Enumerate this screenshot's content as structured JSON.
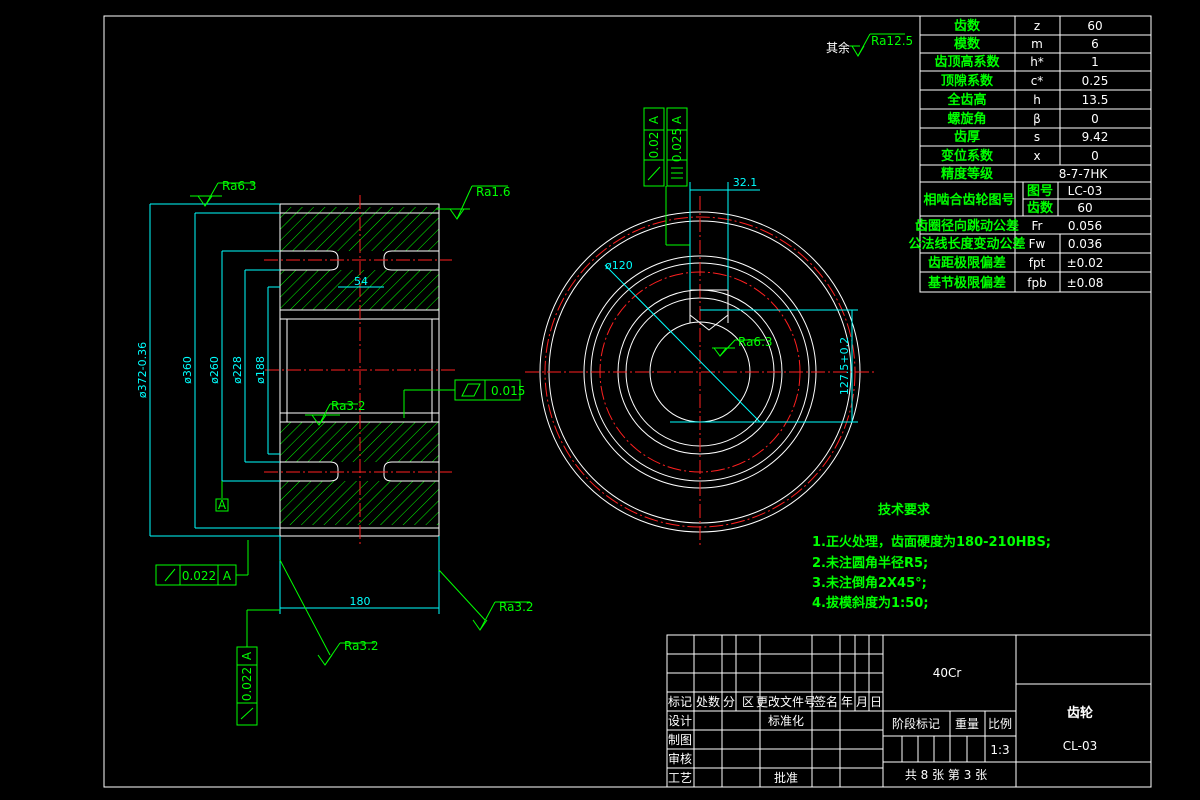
{
  "dimensions": {
    "face_width": "180",
    "hub_width": "54",
    "d_outer": "ø372-0.36",
    "d_360": "ø360",
    "d_260": "ø260",
    "d_228": "ø228",
    "d_188": "ø188",
    "d_bore": "ø120",
    "key_width": "32.1",
    "key_depth": "127.5+0.2"
  },
  "roughness": {
    "ra63": "Ra6.3",
    "ra16": "Ra1.6",
    "ra32_web": "Ra3.2",
    "ra32_left": "Ra3.2",
    "ra32_right": "Ra3.2",
    "ra32_key": "Ra6.3",
    "remainder_prefix": "其余",
    "remainder_ra": "Ra12.5"
  },
  "tolerances": {
    "flat_val": "0.015",
    "runout_face_val": "0.022",
    "runout_face_ref": "A",
    "runout_radial_val": "0.022",
    "runout_radial_ref": "A",
    "sym_val": "0.025",
    "sym_ref": "A",
    "run_key_val": "0.02",
    "run_key_ref": "A",
    "datum": "A"
  },
  "params": [
    {
      "name": "齿数",
      "sym": "z",
      "val": "60"
    },
    {
      "name": "模数",
      "sym": "m",
      "val": "6"
    },
    {
      "name": "齿顶高系数",
      "sym": "h*",
      "val": "1"
    },
    {
      "name": "顶隙系数",
      "sym": "c*",
      "val": "0.25"
    },
    {
      "name": "全齿高",
      "sym": "h",
      "val": "13.5"
    },
    {
      "name": "螺旋角",
      "sym": "β",
      "val": "0"
    },
    {
      "name": "齿厚",
      "sym": "s",
      "val": "9.42"
    },
    {
      "name": "变位系数",
      "sym": "x",
      "val": "0"
    },
    {
      "name": "精度等级",
      "val": "8-7-7HK"
    },
    {
      "name": "相啮合齿轮图号",
      "sym1": "图号",
      "val1": "LC-03",
      "sym2": "齿数",
      "val2": "60"
    },
    {
      "name": "齿圈径向跳动公差",
      "sym": "Fr",
      "val": "0.056"
    },
    {
      "name": "公法线长度变动公差",
      "sym": "Fw",
      "val": "0.036"
    },
    {
      "name": "齿距极限偏差",
      "sym": "fpt",
      "val": "±0.02"
    },
    {
      "name": "基节极限偏差",
      "sym": "fpb",
      "val": "±0.08"
    }
  ],
  "tech": {
    "title": "技术要求",
    "items": [
      "1.正火处理，齿面硬度为180-210HBS;",
      "2.未注圆角半径R5;",
      "3.未注倒角2X45°;",
      "4.拔模斜度为1:50;"
    ]
  },
  "title_block": {
    "material": "40Cr",
    "part_name": "齿轮",
    "drawing_no": "CL-03",
    "rev_headers": [
      "标记",
      "处数",
      "分",
      "区",
      "更改文件号",
      "签名",
      "年",
      "月",
      "日"
    ],
    "designer": "设计",
    "std": "标准化",
    "checker": "审核",
    "process": "工艺",
    "approve": "批准",
    "draw": "制图",
    "stage": "阶段标记",
    "weight": "重量",
    "scale_lbl": "比例",
    "scale": "1:3",
    "sheets": "共 8 张  第 3 张"
  }
}
